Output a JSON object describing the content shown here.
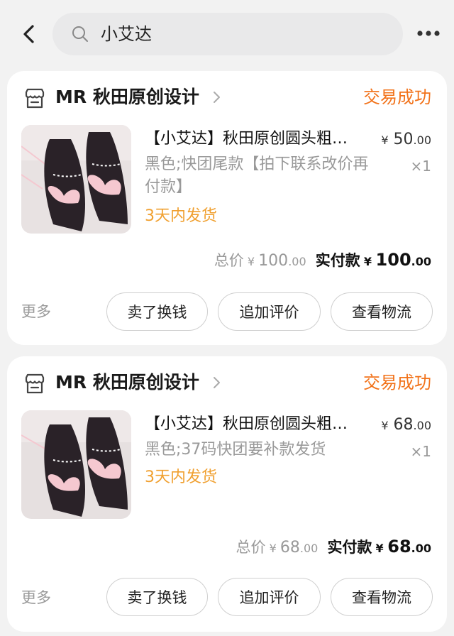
{
  "header": {
    "search_text": "小艾达"
  },
  "colors": {
    "accent_orange": "#f2731b",
    "ship_orange": "#f0a030",
    "muted": "#999999"
  },
  "orders": [
    {
      "shop_name": "MR 秋田原创设计",
      "status": "交易成功",
      "title": "【小艾达】秋田原创圆头粗…",
      "price": {
        "symbol": "¥",
        "int": "50",
        "dec": ".00"
      },
      "spec": "黑色;快团尾款【拍下联系改价再付款】",
      "qty": "×1",
      "ship_note": "3天内发货",
      "total_label": "总价",
      "total": {
        "symbol": "¥",
        "int": "100",
        "dec": ".00"
      },
      "paid_label": "实付款",
      "paid": {
        "symbol": "¥",
        "int": "100",
        "dec": ".00"
      },
      "more_label": "更多",
      "buttons": [
        "卖了换钱",
        "追加评价",
        "查看物流"
      ]
    },
    {
      "shop_name": "MR 秋田原创设计",
      "status": "交易成功",
      "title": "【小艾达】秋田原创圆头粗…",
      "price": {
        "symbol": "¥",
        "int": "68",
        "dec": ".00"
      },
      "spec": "黑色;37码快团要补款发货",
      "qty": "×1",
      "ship_note": "3天内发货",
      "total_label": "总价",
      "total": {
        "symbol": "¥",
        "int": "68",
        "dec": ".00"
      },
      "paid_label": "实付款",
      "paid": {
        "symbol": "¥",
        "int": "68",
        "dec": ".00"
      },
      "more_label": "更多",
      "buttons": [
        "卖了换钱",
        "追加评价",
        "查看物流"
      ]
    }
  ]
}
